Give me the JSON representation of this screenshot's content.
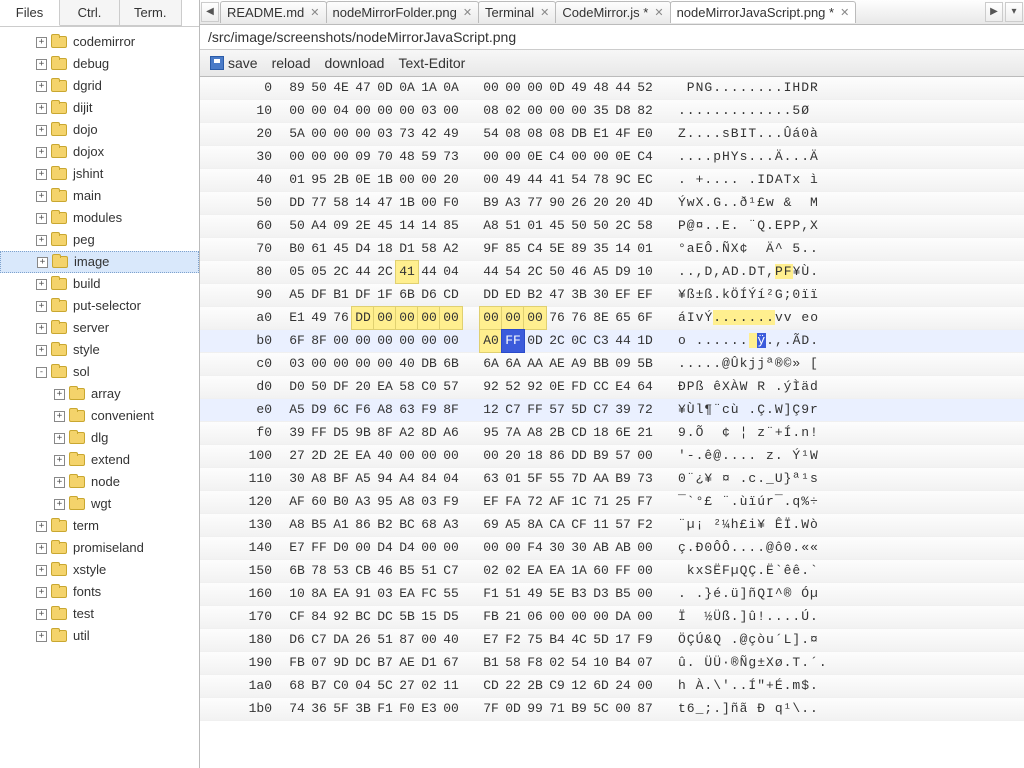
{
  "leftTabs": [
    {
      "label": "Files",
      "active": true
    },
    {
      "label": "Ctrl.",
      "active": false
    },
    {
      "label": "Term.",
      "active": false
    }
  ],
  "tree": [
    {
      "indent": 2,
      "exp": "+",
      "label": "codemirror"
    },
    {
      "indent": 2,
      "exp": "+",
      "label": "debug"
    },
    {
      "indent": 2,
      "exp": "+",
      "label": "dgrid"
    },
    {
      "indent": 2,
      "exp": "+",
      "label": "dijit"
    },
    {
      "indent": 2,
      "exp": "+",
      "label": "dojo"
    },
    {
      "indent": 2,
      "exp": "+",
      "label": "dojox"
    },
    {
      "indent": 2,
      "exp": "+",
      "label": "jshint"
    },
    {
      "indent": 2,
      "exp": "+",
      "label": "main"
    },
    {
      "indent": 2,
      "exp": "+",
      "label": "modules"
    },
    {
      "indent": 2,
      "exp": "+",
      "label": "peg"
    },
    {
      "indent": 2,
      "exp": "+",
      "label": "image",
      "selected": true
    },
    {
      "indent": 2,
      "exp": "+",
      "label": "build"
    },
    {
      "indent": 2,
      "exp": "+",
      "label": "put-selector"
    },
    {
      "indent": 2,
      "exp": "+",
      "label": "server"
    },
    {
      "indent": 2,
      "exp": "+",
      "label": "style"
    },
    {
      "indent": 2,
      "exp": "-",
      "label": "sol"
    },
    {
      "indent": 3,
      "exp": "+",
      "label": "array"
    },
    {
      "indent": 3,
      "exp": "+",
      "label": "convenient"
    },
    {
      "indent": 3,
      "exp": "+",
      "label": "dlg"
    },
    {
      "indent": 3,
      "exp": "+",
      "label": "extend"
    },
    {
      "indent": 3,
      "exp": "+",
      "label": "node"
    },
    {
      "indent": 3,
      "exp": "+",
      "label": "wgt"
    },
    {
      "indent": 2,
      "exp": "+",
      "label": "term"
    },
    {
      "indent": 2,
      "exp": "+",
      "label": "promiseland"
    },
    {
      "indent": 2,
      "exp": "+",
      "label": "xstyle"
    },
    {
      "indent": 2,
      "exp": "+",
      "label": "fonts"
    },
    {
      "indent": 2,
      "exp": "+",
      "label": "test"
    },
    {
      "indent": 2,
      "exp": "+",
      "label": "util"
    }
  ],
  "fileTabs": [
    {
      "label": "README.md",
      "active": false
    },
    {
      "label": "nodeMirrorFolder.png",
      "active": false
    },
    {
      "label": "Terminal",
      "active": false
    },
    {
      "label": "CodeMirror.js *",
      "active": false
    },
    {
      "label": "nodeMirrorJavaScript.png *",
      "active": true
    }
  ],
  "path": "/src/image/screenshots/nodeMirrorJavaScript.png",
  "toolbar": {
    "save": "save",
    "reload": "reload",
    "download": "download",
    "textEditor": "Text-Editor"
  },
  "hex": [
    {
      "off": "0",
      "a": [
        "89",
        "50",
        "4E",
        "47",
        "0D",
        "0A",
        "1A",
        "0A"
      ],
      "b": [
        "00",
        "00",
        "00",
        "0D",
        "49",
        "48",
        "44",
        "52"
      ],
      "ascii": " PNG........IHDR"
    },
    {
      "off": "10",
      "a": [
        "00",
        "00",
        "04",
        "00",
        "00",
        "00",
        "03",
        "00"
      ],
      "b": [
        "08",
        "02",
        "00",
        "00",
        "00",
        "35",
        "D8",
        "82"
      ],
      "ascii": ".............5Ø "
    },
    {
      "off": "20",
      "a": [
        "5A",
        "00",
        "00",
        "00",
        "03",
        "73",
        "42",
        "49"
      ],
      "b": [
        "54",
        "08",
        "08",
        "08",
        "DB",
        "E1",
        "4F",
        "E0"
      ],
      "ascii": "Z....sBIT...Ûá0à"
    },
    {
      "off": "30",
      "a": [
        "00",
        "00",
        "00",
        "09",
        "70",
        "48",
        "59",
        "73"
      ],
      "b": [
        "00",
        "00",
        "0E",
        "C4",
        "00",
        "00",
        "0E",
        "C4"
      ],
      "ascii": "....pHYs...Ä...Ä"
    },
    {
      "off": "40",
      "a": [
        "01",
        "95",
        "2B",
        "0E",
        "1B",
        "00",
        "00",
        "20"
      ],
      "b": [
        "00",
        "49",
        "44",
        "41",
        "54",
        "78",
        "9C",
        "EC"
      ],
      "ascii": ". +.... .IDATx ì"
    },
    {
      "off": "50",
      "a": [
        "DD",
        "77",
        "58",
        "14",
        "47",
        "1B",
        "00",
        "F0"
      ],
      "b": [
        "B9",
        "A3",
        "77",
        "90",
        "26",
        "20",
        "20",
        "4D"
      ],
      "ascii": "ÝwX.G..ð¹£w &  M"
    },
    {
      "off": "60",
      "a": [
        "50",
        "A4",
        "09",
        "2E",
        "45",
        "14",
        "14",
        "85"
      ],
      "b": [
        "A8",
        "51",
        "01",
        "45",
        "50",
        "50",
        "2C",
        "58"
      ],
      "ascii": "P@¤..E. ¨Q.EPP,X"
    },
    {
      "off": "70",
      "a": [
        "B0",
        "61",
        "45",
        "D4",
        "18",
        "D1",
        "58",
        "A2"
      ],
      "b": [
        "9F",
        "85",
        "C4",
        "5E",
        "89",
        "35",
        "14",
        "01"
      ],
      "ascii": "°aEÔ.ÑX¢  Ä^ 5.."
    },
    {
      "off": "80",
      "a": [
        "05",
        "05",
        "2C",
        "44",
        "2C",
        "41",
        "44",
        "04"
      ],
      "b": [
        "44",
        "54",
        "2C",
        "50",
        "46",
        "A5",
        "D9",
        "10"
      ],
      "hlA": {
        "5": "y"
      },
      "ascii": "..,D,AD.DT,PF¥Ù.",
      "chl": {
        "11": "y",
        "12": "y"
      }
    },
    {
      "off": "90",
      "a": [
        "A5",
        "DF",
        "B1",
        "DF",
        "1F",
        "6B",
        "D6",
        "CD"
      ],
      "b": [
        "DD",
        "ED",
        "B2",
        "47",
        "3B",
        "30",
        "EF",
        "EF"
      ],
      "ascii": "¥ß±ß.kÖÍÝí²G;0ïï"
    },
    {
      "off": "a0",
      "a": [
        "E1",
        "49",
        "76",
        "DD",
        "00",
        "00",
        "00",
        "00"
      ],
      "b": [
        "00",
        "00",
        "00",
        "76",
        "76",
        "8E",
        "65",
        "6F"
      ],
      "hlA": {
        "3": "y",
        "4": "y",
        "5": "y",
        "6": "y",
        "7": "y"
      },
      "hlB": {
        "0": "y",
        "1": "y",
        "2": "y"
      },
      "ascii": "áIvÝ.......vv eo",
      "chl": {
        "4": "y",
        "5": "y",
        "6": "y",
        "7": "y",
        "8": "y",
        "9": "y",
        "10": "y"
      }
    },
    {
      "off": "b0",
      "a": [
        "6F",
        "8F",
        "00",
        "00",
        "00",
        "00",
        "00",
        "00"
      ],
      "b": [
        "A0",
        "FF",
        "0D",
        "2C",
        "0C",
        "C3",
        "44",
        "1D"
      ],
      "hlB": {
        "0": "y",
        "1": "b"
      },
      "ascii": "o ...... ÿ.,.ÃD.",
      "chl": {
        "8": "y",
        "9": "b"
      },
      "rowhl": true
    },
    {
      "off": "c0",
      "a": [
        "03",
        "00",
        "00",
        "00",
        "00",
        "40",
        "DB",
        "6B"
      ],
      "b": [
        "6A",
        "6A",
        "AA",
        "AE",
        "A9",
        "BB",
        "09",
        "5B"
      ],
      "ascii": ".....@Ûkjjª®©» ["
    },
    {
      "off": "d0",
      "a": [
        "D0",
        "50",
        "DF",
        "20",
        "EA",
        "58",
        "C0",
        "57"
      ],
      "b": [
        "92",
        "52",
        "92",
        "0E",
        "FD",
        "CC",
        "E4",
        "64"
      ],
      "ascii": "ÐPß êXÀW R .ýÌäd"
    },
    {
      "off": "e0",
      "a": [
        "A5",
        "D9",
        "6C",
        "F6",
        "A8",
        "63",
        "F9",
        "8F"
      ],
      "b": [
        "12",
        "C7",
        "FF",
        "57",
        "5D",
        "C7",
        "39",
        "72"
      ],
      "ascii": "¥Ùl¶¨cù .Ç.W]Ç9r",
      "rowhl": true
    },
    {
      "off": "f0",
      "a": [
        "39",
        "FF",
        "D5",
        "9B",
        "8F",
        "A2",
        "8D",
        "A6"
      ],
      "b": [
        "95",
        "7A",
        "A8",
        "2B",
        "CD",
        "18",
        "6E",
        "21"
      ],
      "ascii": "9.Õ  ¢ ¦ z¨+Í.n!"
    },
    {
      "off": "100",
      "a": [
        "27",
        "2D",
        "2E",
        "EA",
        "40",
        "00",
        "00",
        "00"
      ],
      "b": [
        "00",
        "20",
        "18",
        "86",
        "DD",
        "B9",
        "57",
        "00"
      ],
      "ascii": "'-.ê@.... z. Ý¹W"
    },
    {
      "off": "110",
      "a": [
        "30",
        "A8",
        "BF",
        "A5",
        "94",
        "A4",
        "84",
        "04"
      ],
      "b": [
        "63",
        "01",
        "5F",
        "55",
        "7D",
        "AA",
        "B9",
        "73"
      ],
      "ascii": "0¨¿¥ ¤ .c._U}ª¹s"
    },
    {
      "off": "120",
      "a": [
        "AF",
        "60",
        "B0",
        "A3",
        "95",
        "A8",
        "03",
        "F9"
      ],
      "b": [
        "EF",
        "FA",
        "72",
        "AF",
        "1C",
        "71",
        "25",
        "F7"
      ],
      "ascii": "¯`°£ ¨.ùïúr¯.q%÷"
    },
    {
      "off": "130",
      "a": [
        "A8",
        "B5",
        "A1",
        "86",
        "B2",
        "BC",
        "68",
        "A3"
      ],
      "b": [
        "69",
        "A5",
        "8A",
        "CA",
        "CF",
        "11",
        "57",
        "F2"
      ],
      "ascii": "¨µ¡ ²¼h£i¥ ÊÏ.Wò"
    },
    {
      "off": "140",
      "a": [
        "E7",
        "FF",
        "D0",
        "00",
        "D4",
        "D4",
        "00",
        "00"
      ],
      "b": [
        "00",
        "00",
        "F4",
        "30",
        "30",
        "AB",
        "AB",
        "00"
      ],
      "ascii": "ç.Ð0ÔÔ....@ô0.««"
    },
    {
      "off": "150",
      "a": [
        "6B",
        "78",
        "53",
        "CB",
        "46",
        "B5",
        "51",
        "C7"
      ],
      "b": [
        "02",
        "02",
        "EA",
        "EA",
        "1A",
        "60",
        "FF",
        "00"
      ],
      "ascii": " kxSËFµQÇ.Ë`êê.`"
    },
    {
      "off": "160",
      "a": [
        "10",
        "8A",
        "EA",
        "91",
        "03",
        "EA",
        "FC",
        "55"
      ],
      "b": [
        "F1",
        "51",
        "49",
        "5E",
        "B3",
        "D3",
        "B5",
        "00"
      ],
      "ascii": ". .}é.ü]ñQI^® Óµ"
    },
    {
      "off": "170",
      "a": [
        "CF",
        "84",
        "92",
        "BC",
        "DC",
        "5B",
        "15",
        "D5"
      ],
      "b": [
        "FB",
        "21",
        "06",
        "00",
        "00",
        "00",
        "DA",
        "00"
      ],
      "ascii": "Ï  ½Üß.]û!....Ú."
    },
    {
      "off": "180",
      "a": [
        "D6",
        "C7",
        "DA",
        "26",
        "51",
        "87",
        "00",
        "40"
      ],
      "b": [
        "E7",
        "F2",
        "75",
        "B4",
        "4C",
        "5D",
        "17",
        "F9"
      ],
      "ascii": "ÖÇÚ&Q .@çòu´L].¤"
    },
    {
      "off": "190",
      "a": [
        "FB",
        "07",
        "9D",
        "DC",
        "B7",
        "AE",
        "D1",
        "67"
      ],
      "b": [
        "B1",
        "58",
        "F8",
        "02",
        "54",
        "10",
        "B4",
        "07"
      ],
      "ascii": "û. ÜÜ·®Ñg±Xø.T.´."
    },
    {
      "off": "1a0",
      "a": [
        "68",
        "B7",
        "C0",
        "04",
        "5C",
        "27",
        "02",
        "11"
      ],
      "b": [
        "CD",
        "22",
        "2B",
        "C9",
        "12",
        "6D",
        "24",
        "00"
      ],
      "ascii": "h À.\\'..Í\"+É.m$."
    },
    {
      "off": "1b0",
      "a": [
        "74",
        "36",
        "5F",
        "3B",
        "F1",
        "F0",
        "E3",
        "00"
      ],
      "b": [
        "7F",
        "0D",
        "99",
        "71",
        "B9",
        "5C",
        "00",
        "87"
      ],
      "ascii": "t6_;.]ñã Ð q¹\\.."
    }
  ]
}
